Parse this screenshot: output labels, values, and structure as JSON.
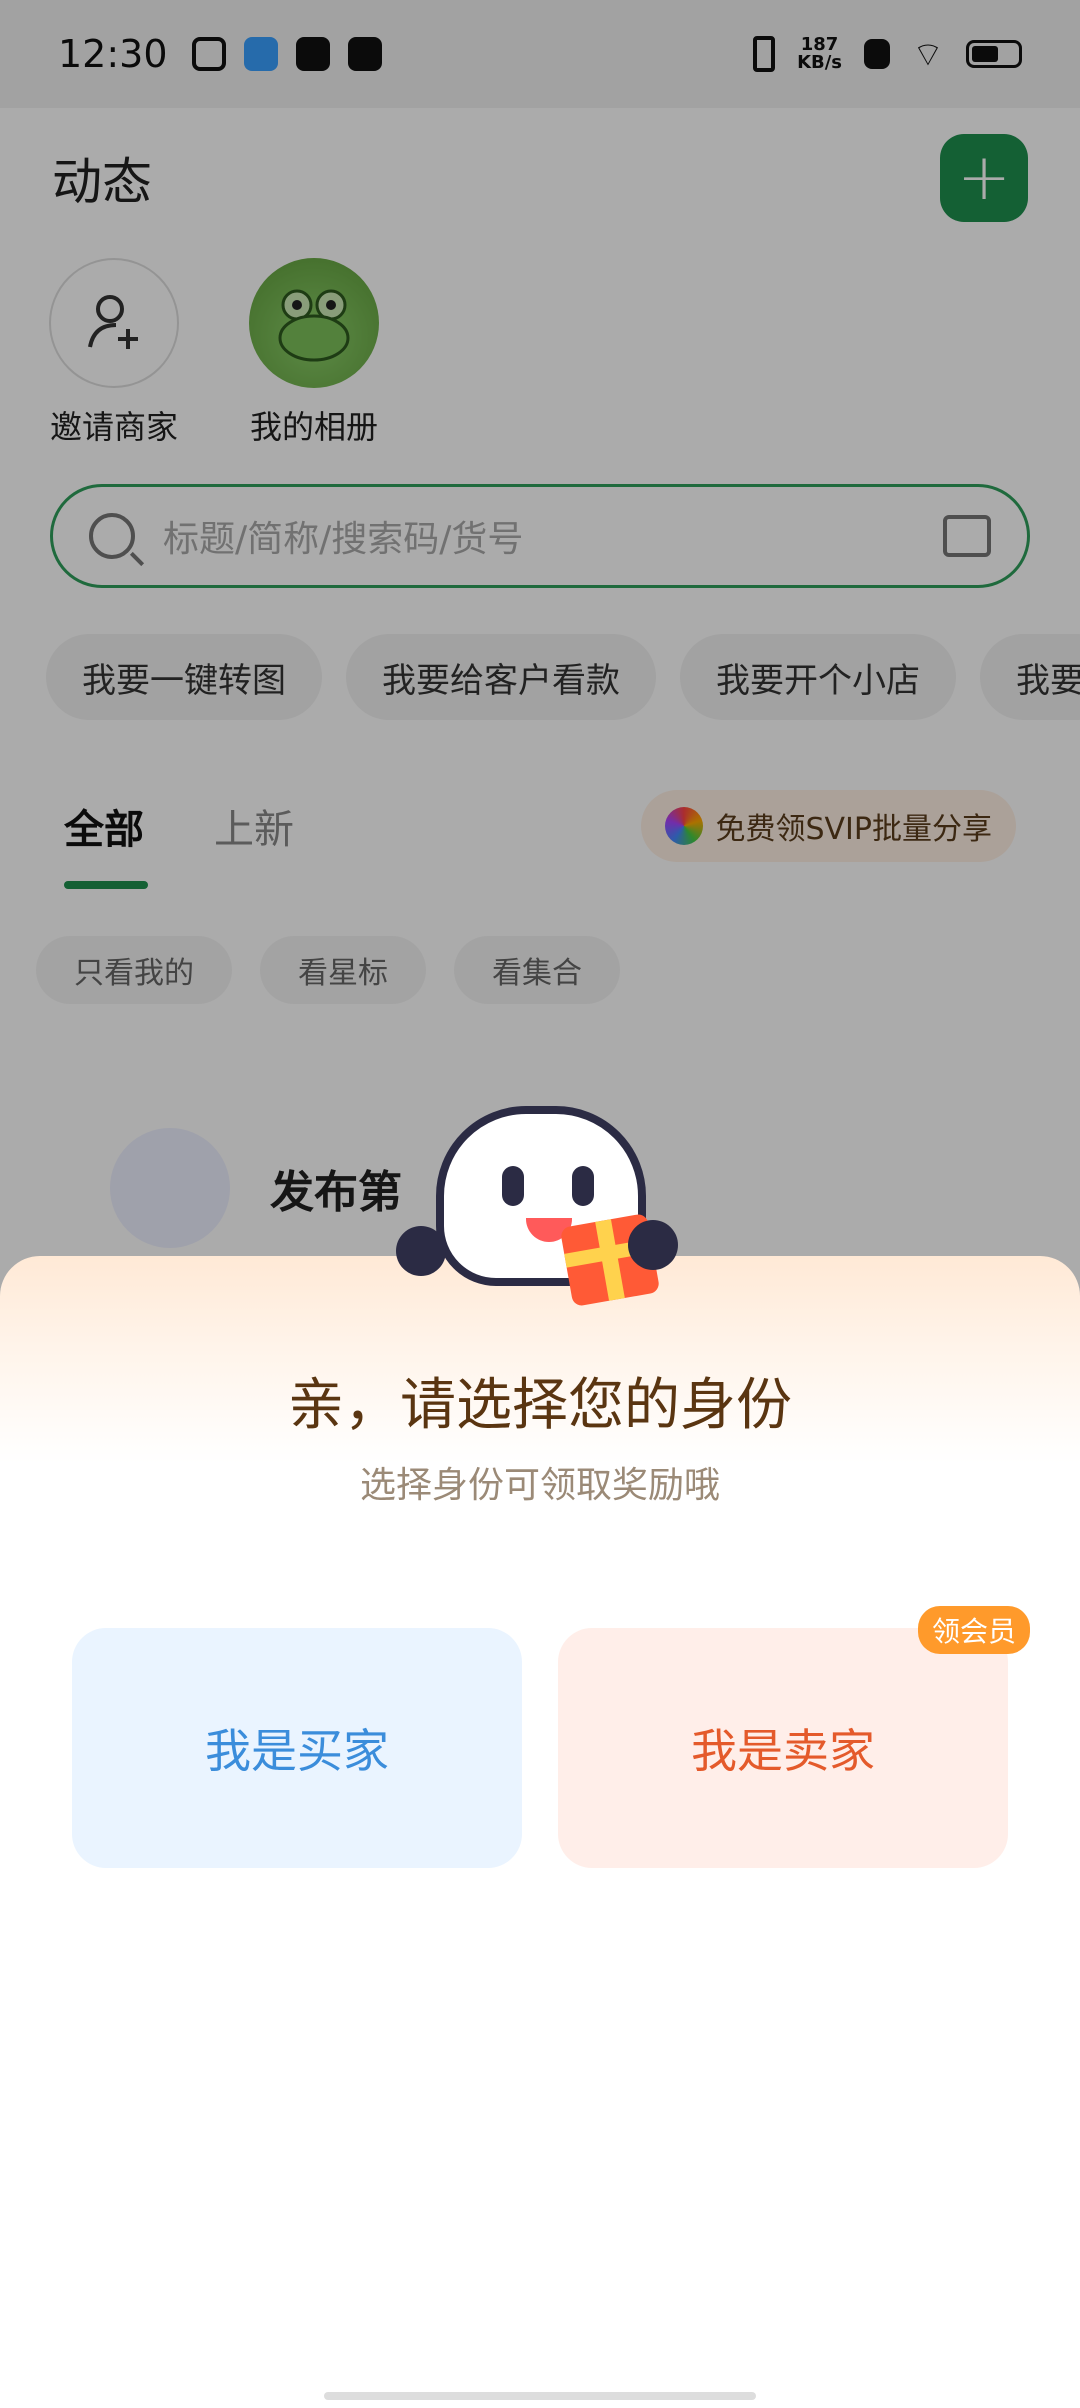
{
  "status_bar": {
    "time": "12:30",
    "network_speed_value": "187",
    "network_speed_unit": "KB/s"
  },
  "header": {
    "title": "动态",
    "add_label": "+"
  },
  "quick": [
    {
      "label": "邀请商家",
      "icon": "add-user-icon"
    },
    {
      "label": "我的相册",
      "icon": "frog-avatar"
    }
  ],
  "search": {
    "placeholder": "标题/简称/搜索码/货号"
  },
  "chips": [
    "我要一键转图",
    "我要给客户看款",
    "我要开个小店",
    "我要"
  ],
  "tabs": [
    "全部",
    "上新"
  ],
  "promo": {
    "label": "免费领SVIP批量分享"
  },
  "filters": [
    "只看我的",
    "看星标",
    "看集合"
  ],
  "publish": {
    "label": "发布第"
  },
  "sheet": {
    "title": "亲，请选择您的身份",
    "subtitle": "选择身份可领取奖励哦",
    "buyer": "我是买家",
    "seller": "我是卖家",
    "badge": "领会员"
  }
}
